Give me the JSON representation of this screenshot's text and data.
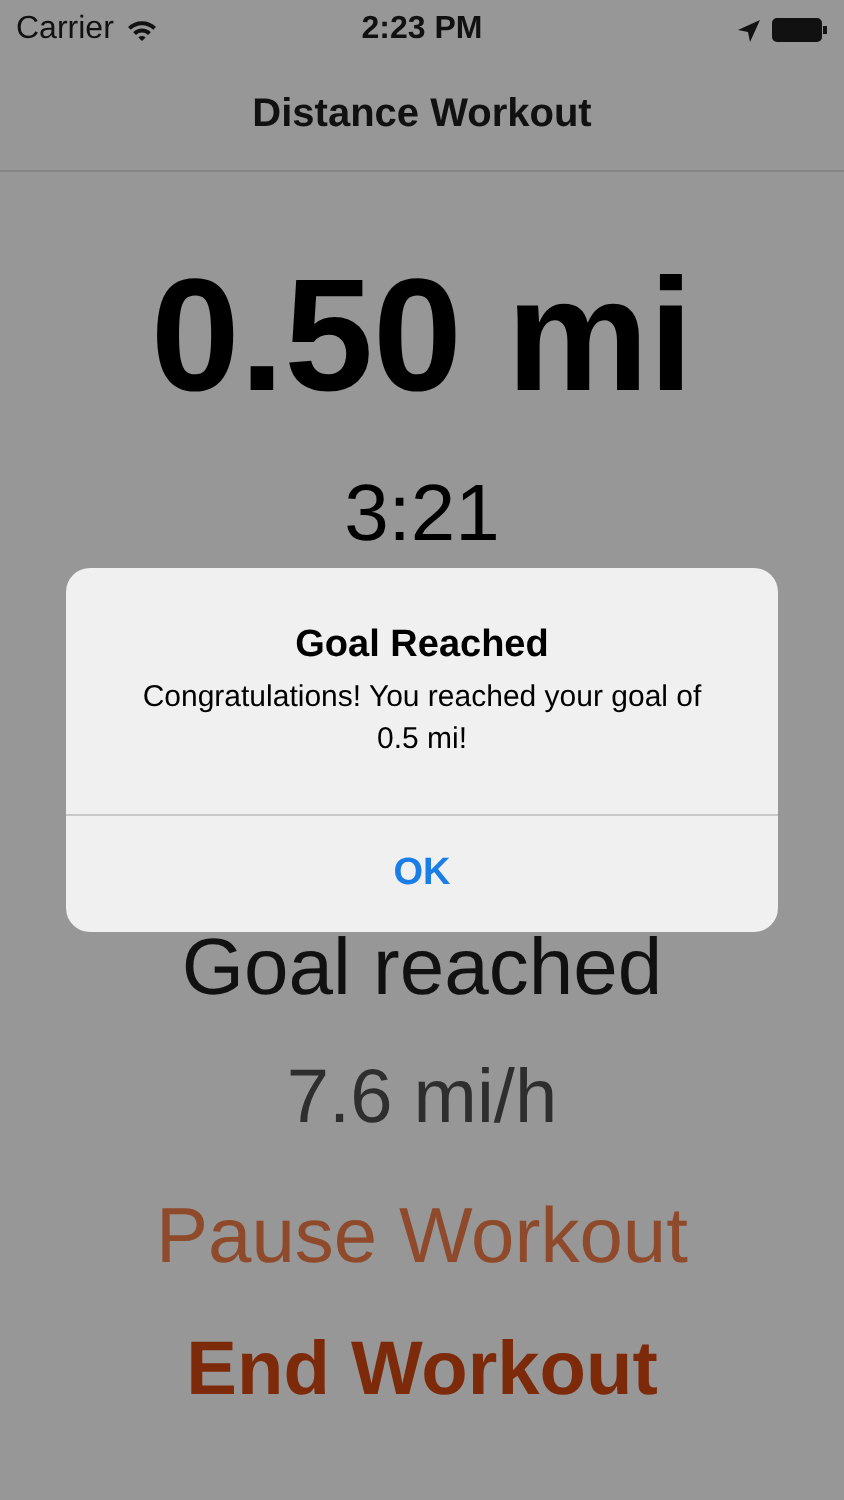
{
  "status_bar": {
    "carrier": "Carrier",
    "time": "2:23 PM"
  },
  "nav": {
    "title": "Distance Workout"
  },
  "workout": {
    "distance": "0.50 mi",
    "elapsed": "3:21",
    "goal_status": "Goal reached",
    "speed": "7.6 mi/h"
  },
  "actions": [
    {
      "label": "Pause Workout",
      "kind": "secondary"
    },
    {
      "label": "End Workout",
      "kind": "primary"
    }
  ],
  "alert": {
    "title": "Goal Reached",
    "message": "Congratulations! You reached your goal of 0.5 mi!",
    "buttons": [
      "OK"
    ]
  }
}
